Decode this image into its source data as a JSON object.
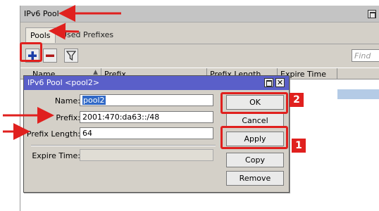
{
  "window": {
    "title": "IPv6 Pool"
  },
  "tabs": [
    {
      "label": "Pools"
    },
    {
      "label": "Used Prefixes"
    }
  ],
  "toolbar": {
    "add_icon": "plus-icon",
    "remove_icon": "minus-icon",
    "filter_icon": "funnel-icon",
    "find_placeholder": "Find"
  },
  "table": {
    "columns": [
      "Name",
      "Prefix",
      "Prefix Length",
      "Expire Time"
    ]
  },
  "dialog": {
    "title": "IPv6 Pool <pool2>",
    "name_label": "Name:",
    "name_value": "pool2",
    "prefix_label": "Prefix:",
    "prefix_value": "2001:470:da63::/48",
    "prefix_length_label": "Prefix Length:",
    "prefix_length_value": "64",
    "expire_time_label": "Expire Time:",
    "expire_time_value": "",
    "buttons": {
      "ok": "OK",
      "cancel": "Cancel",
      "apply": "Apply",
      "copy": "Copy",
      "remove": "Remove"
    }
  },
  "annotations": {
    "badge_ok": "2",
    "badge_apply": "1",
    "color": "#e0201e"
  }
}
